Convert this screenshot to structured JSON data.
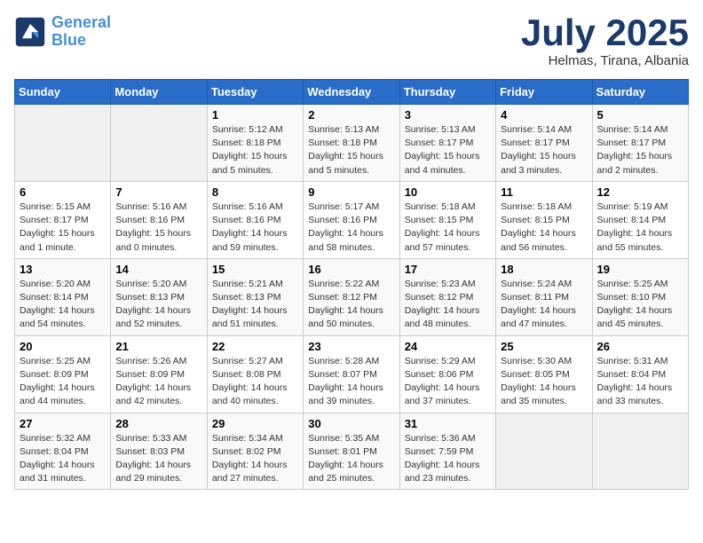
{
  "logo": {
    "line1": "General",
    "line2": "Blue"
  },
  "title": "July 2025",
  "subtitle": "Helmas, Tirana, Albania",
  "weekdays": [
    "Sunday",
    "Monday",
    "Tuesday",
    "Wednesday",
    "Thursday",
    "Friday",
    "Saturday"
  ],
  "weeks": [
    [
      {
        "day": "",
        "detail": ""
      },
      {
        "day": "",
        "detail": ""
      },
      {
        "day": "1",
        "detail": "Sunrise: 5:12 AM\nSunset: 8:18 PM\nDaylight: 15 hours and 5 minutes."
      },
      {
        "day": "2",
        "detail": "Sunrise: 5:13 AM\nSunset: 8:18 PM\nDaylight: 15 hours and 5 minutes."
      },
      {
        "day": "3",
        "detail": "Sunrise: 5:13 AM\nSunset: 8:17 PM\nDaylight: 15 hours and 4 minutes."
      },
      {
        "day": "4",
        "detail": "Sunrise: 5:14 AM\nSunset: 8:17 PM\nDaylight: 15 hours and 3 minutes."
      },
      {
        "day": "5",
        "detail": "Sunrise: 5:14 AM\nSunset: 8:17 PM\nDaylight: 15 hours and 2 minutes."
      }
    ],
    [
      {
        "day": "6",
        "detail": "Sunrise: 5:15 AM\nSunset: 8:17 PM\nDaylight: 15 hours and 1 minute."
      },
      {
        "day": "7",
        "detail": "Sunrise: 5:16 AM\nSunset: 8:16 PM\nDaylight: 15 hours and 0 minutes."
      },
      {
        "day": "8",
        "detail": "Sunrise: 5:16 AM\nSunset: 8:16 PM\nDaylight: 14 hours and 59 minutes."
      },
      {
        "day": "9",
        "detail": "Sunrise: 5:17 AM\nSunset: 8:16 PM\nDaylight: 14 hours and 58 minutes."
      },
      {
        "day": "10",
        "detail": "Sunrise: 5:18 AM\nSunset: 8:15 PM\nDaylight: 14 hours and 57 minutes."
      },
      {
        "day": "11",
        "detail": "Sunrise: 5:18 AM\nSunset: 8:15 PM\nDaylight: 14 hours and 56 minutes."
      },
      {
        "day": "12",
        "detail": "Sunrise: 5:19 AM\nSunset: 8:14 PM\nDaylight: 14 hours and 55 minutes."
      }
    ],
    [
      {
        "day": "13",
        "detail": "Sunrise: 5:20 AM\nSunset: 8:14 PM\nDaylight: 14 hours and 54 minutes."
      },
      {
        "day": "14",
        "detail": "Sunrise: 5:20 AM\nSunset: 8:13 PM\nDaylight: 14 hours and 52 minutes."
      },
      {
        "day": "15",
        "detail": "Sunrise: 5:21 AM\nSunset: 8:13 PM\nDaylight: 14 hours and 51 minutes."
      },
      {
        "day": "16",
        "detail": "Sunrise: 5:22 AM\nSunset: 8:12 PM\nDaylight: 14 hours and 50 minutes."
      },
      {
        "day": "17",
        "detail": "Sunrise: 5:23 AM\nSunset: 8:12 PM\nDaylight: 14 hours and 48 minutes."
      },
      {
        "day": "18",
        "detail": "Sunrise: 5:24 AM\nSunset: 8:11 PM\nDaylight: 14 hours and 47 minutes."
      },
      {
        "day": "19",
        "detail": "Sunrise: 5:25 AM\nSunset: 8:10 PM\nDaylight: 14 hours and 45 minutes."
      }
    ],
    [
      {
        "day": "20",
        "detail": "Sunrise: 5:25 AM\nSunset: 8:09 PM\nDaylight: 14 hours and 44 minutes."
      },
      {
        "day": "21",
        "detail": "Sunrise: 5:26 AM\nSunset: 8:09 PM\nDaylight: 14 hours and 42 minutes."
      },
      {
        "day": "22",
        "detail": "Sunrise: 5:27 AM\nSunset: 8:08 PM\nDaylight: 14 hours and 40 minutes."
      },
      {
        "day": "23",
        "detail": "Sunrise: 5:28 AM\nSunset: 8:07 PM\nDaylight: 14 hours and 39 minutes."
      },
      {
        "day": "24",
        "detail": "Sunrise: 5:29 AM\nSunset: 8:06 PM\nDaylight: 14 hours and 37 minutes."
      },
      {
        "day": "25",
        "detail": "Sunrise: 5:30 AM\nSunset: 8:05 PM\nDaylight: 14 hours and 35 minutes."
      },
      {
        "day": "26",
        "detail": "Sunrise: 5:31 AM\nSunset: 8:04 PM\nDaylight: 14 hours and 33 minutes."
      }
    ],
    [
      {
        "day": "27",
        "detail": "Sunrise: 5:32 AM\nSunset: 8:04 PM\nDaylight: 14 hours and 31 minutes."
      },
      {
        "day": "28",
        "detail": "Sunrise: 5:33 AM\nSunset: 8:03 PM\nDaylight: 14 hours and 29 minutes."
      },
      {
        "day": "29",
        "detail": "Sunrise: 5:34 AM\nSunset: 8:02 PM\nDaylight: 14 hours and 27 minutes."
      },
      {
        "day": "30",
        "detail": "Sunrise: 5:35 AM\nSunset: 8:01 PM\nDaylight: 14 hours and 25 minutes."
      },
      {
        "day": "31",
        "detail": "Sunrise: 5:36 AM\nSunset: 7:59 PM\nDaylight: 14 hours and 23 minutes."
      },
      {
        "day": "",
        "detail": ""
      },
      {
        "day": "",
        "detail": ""
      }
    ]
  ]
}
